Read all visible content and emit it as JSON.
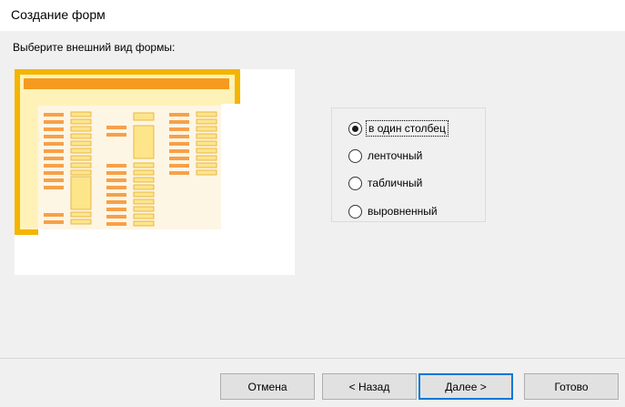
{
  "window": {
    "title": "Создание форм"
  },
  "wizard": {
    "prompt": "Выберите внешний вид формы:",
    "preview_icon": "form-layout-columnar-preview",
    "options": [
      {
        "label": "в один столбец",
        "selected": true
      },
      {
        "label": "ленточный",
        "selected": false
      },
      {
        "label": "табличный",
        "selected": false
      },
      {
        "label": "выровненный",
        "selected": false
      }
    ]
  },
  "buttons": {
    "cancel": "Отмена",
    "back": "< Назад",
    "next": "Далее >",
    "finish": "Готово"
  },
  "colors": {
    "preview_frame": "#f5b400",
    "preview_header": "#f59a1e",
    "preview_bg": "#fef6e4",
    "label_bar": "#f7a04a",
    "field_fill": "#fde58a",
    "field_border": "#e8b84a",
    "default_button_border": "#0078d7"
  }
}
